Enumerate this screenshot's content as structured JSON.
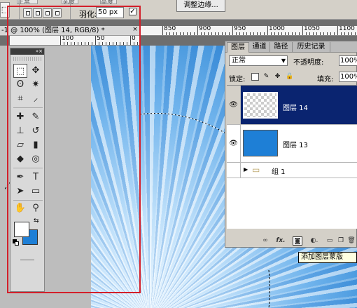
{
  "options_bar": {
    "tool_preset_icon": "marquee-icon",
    "top_ghost_labels": [
      "正常",
      "宽度",
      "高度"
    ],
    "feather_label": "羽化:",
    "feather_value": "50 px",
    "antialias_checked": true,
    "refine_edge_label": "调整边缘..."
  },
  "document": {
    "tab_title": "-1 @ 100% (图层 14, RGB/8) *",
    "close_glyph": "×",
    "hruler_numbers": [
      "850",
      "900",
      "950",
      "1000",
      "1050",
      "1100"
    ],
    "ruler2_numbers": [
      "100",
      "50",
      "0"
    ]
  },
  "toolbox": {
    "head_glyphs": "»×",
    "tools": [
      {
        "name": "rect-marquee-icon",
        "glyph": "⬚",
        "active": true
      },
      {
        "name": "move-icon",
        "glyph": "✥"
      },
      {
        "name": "lasso-icon",
        "glyph": "ʘ"
      },
      {
        "name": "magic-wand-icon",
        "glyph": "✷"
      },
      {
        "name": "crop-icon",
        "glyph": "⌗"
      },
      {
        "name": "eyedropper-icon",
        "glyph": "⸝"
      },
      {
        "name": "healing-brush-icon",
        "glyph": "✚"
      },
      {
        "name": "brush-icon",
        "glyph": "✎"
      },
      {
        "name": "clone-stamp-icon",
        "glyph": "⊥"
      },
      {
        "name": "history-brush-icon",
        "glyph": "↺"
      },
      {
        "name": "eraser-icon",
        "glyph": "▱"
      },
      {
        "name": "gradient-icon",
        "glyph": "▮"
      },
      {
        "name": "blur-icon",
        "glyph": "◆"
      },
      {
        "name": "dodge-icon",
        "glyph": "◎"
      },
      {
        "name": "pen-icon",
        "glyph": "✒"
      },
      {
        "name": "type-icon",
        "glyph": "T"
      },
      {
        "name": "path-select-icon",
        "glyph": "➤"
      },
      {
        "name": "shape-icon",
        "glyph": "▭"
      },
      {
        "name": "hand-icon",
        "glyph": "✋"
      },
      {
        "name": "zoom-icon",
        "glyph": "⚲"
      }
    ],
    "swap_glyph": "⇆",
    "foreground_color": "#ffffff",
    "background_color": "#1e7fd6"
  },
  "layers_panel": {
    "tabs": [
      "图层",
      "通道",
      "路径",
      "历史记录"
    ],
    "blend_mode": "正常",
    "opacity_label": "不透明度:",
    "opacity_value": "100%",
    "lock_label": "锁定:",
    "fill_label": "填充:",
    "fill_value": "100%",
    "layers": [
      {
        "name": "图层 14",
        "selected": true,
        "thumb": "transparent"
      },
      {
        "name": "图层 13",
        "selected": false,
        "thumb": "#1e7fd6"
      },
      {
        "name": "组 1",
        "selected": false,
        "group": true
      }
    ],
    "eye_glyph": "👁",
    "footer_icons": [
      "link-icon",
      "fx-icon",
      "add-mask-icon",
      "adjustment-icon",
      "group-icon",
      "new-layer-icon",
      "trash-icon"
    ],
    "footer_glyphs": [
      "∞",
      "fx.",
      "◙",
      "◐.",
      "▭",
      "❐",
      "🗑"
    ],
    "tooltip": "添加图层蒙版"
  },
  "colors": {
    "highlight": "#d31f2a",
    "selection_blue": "#0a2470"
  }
}
